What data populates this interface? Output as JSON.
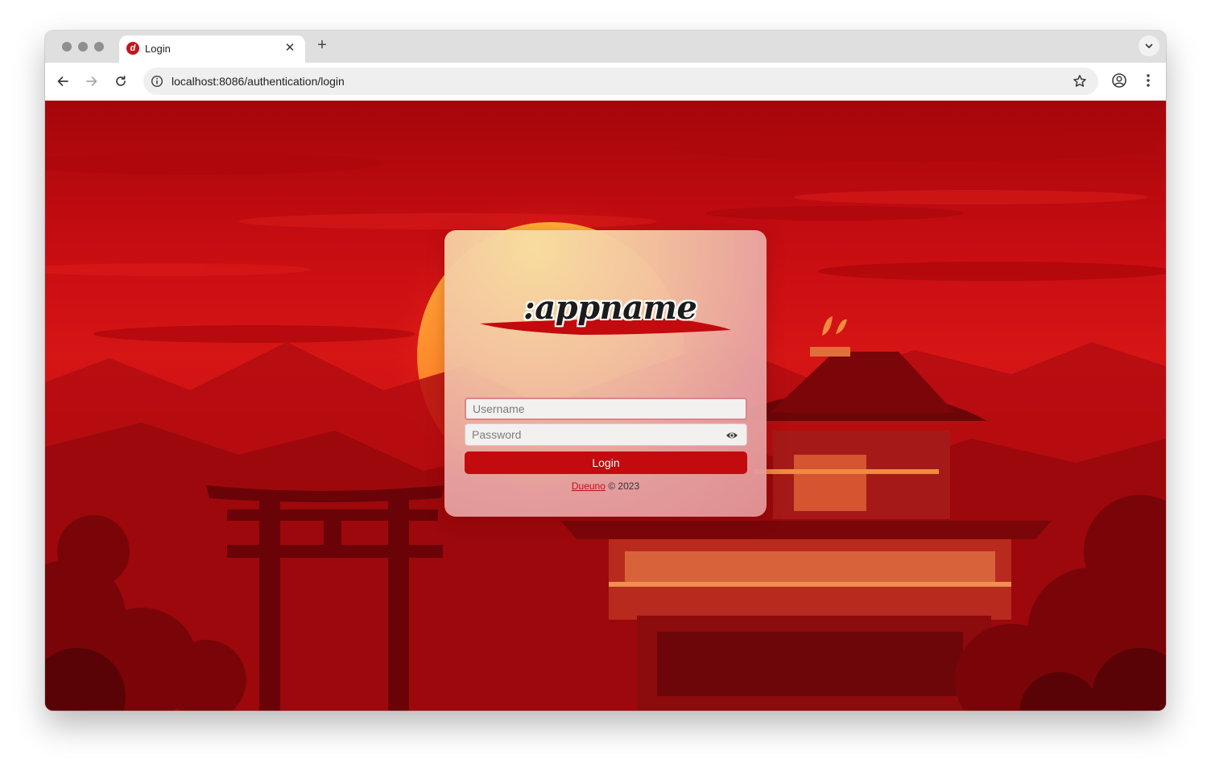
{
  "browser": {
    "tab": {
      "title": "Login",
      "favicon": "app-logo-icon",
      "close_label": "✕"
    },
    "new_tab_label": "+",
    "address": {
      "url": "localhost:8086/authentication/login"
    },
    "icons": [
      "back-arrow-icon",
      "forward-arrow-icon",
      "reload-icon",
      "site-info-icon",
      "bookmark-star-icon",
      "account-icon",
      "more-menu-icon",
      "tab-list-chevron-icon"
    ]
  },
  "login": {
    "logo_text": ":appname",
    "username": {
      "value": "",
      "placeholder": "Username"
    },
    "password": {
      "value": "",
      "placeholder": "Password"
    },
    "submit_label": "Login",
    "footer": {
      "link_text": "Dueuno",
      "copyright": "© 2023"
    }
  },
  "colors": {
    "accent": "#c30a0f",
    "background": "#c80d12",
    "card": "#eab4a8"
  }
}
